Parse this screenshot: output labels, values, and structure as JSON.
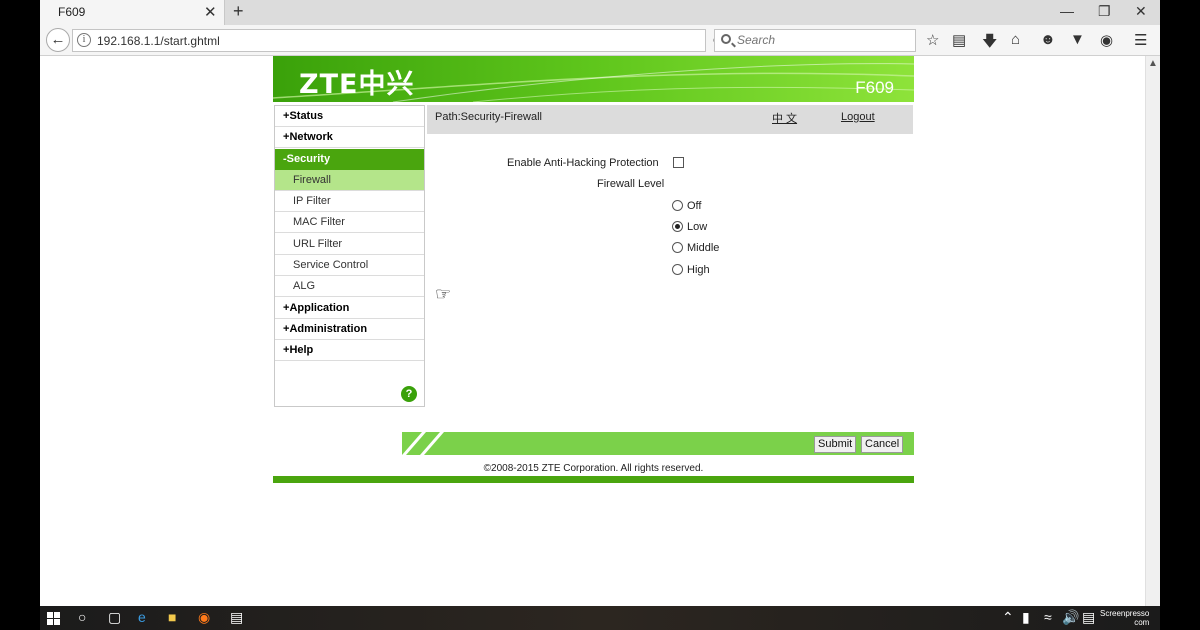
{
  "browser": {
    "tab_title": "F609",
    "tab_close": "✕",
    "new_tab": "+",
    "url": "192.168.1.1/start.ghtml",
    "search_placeholder": "Search",
    "window_controls": [
      "minimize-icon",
      "restore-icon",
      "close-icon"
    ],
    "toolbar_icons": [
      "star-icon",
      "reader-icon",
      "download-icon",
      "home-icon",
      "emoji-icon",
      "pocket-icon",
      "sync-icon",
      "menu-icon"
    ]
  },
  "router": {
    "logo": "ZTE中兴",
    "model": "F609",
    "menu": [
      {
        "sign": "+",
        "label": "Status",
        "level": "top",
        "active": false
      },
      {
        "sign": "+",
        "label": "Network",
        "level": "top",
        "active": false
      },
      {
        "sign": "-",
        "label": "Security",
        "level": "top",
        "active": true
      },
      {
        "sign": "",
        "label": "Firewall",
        "level": "sub",
        "active": true
      },
      {
        "sign": "",
        "label": "IP Filter",
        "level": "sub",
        "active": false
      },
      {
        "sign": "",
        "label": "MAC Filter",
        "level": "sub",
        "active": false
      },
      {
        "sign": "",
        "label": "URL Filter",
        "level": "sub",
        "active": false
      },
      {
        "sign": "",
        "label": "Service Control",
        "level": "sub",
        "active": false
      },
      {
        "sign": "",
        "label": "ALG",
        "level": "sub",
        "active": false
      },
      {
        "sign": "+",
        "label": "Application",
        "level": "top",
        "active": false
      },
      {
        "sign": "+",
        "label": "Administration",
        "level": "top",
        "active": false
      },
      {
        "sign": "+",
        "label": "Help",
        "level": "top",
        "active": false
      }
    ],
    "help_icon": "?",
    "path": "Path:Security-Firewall",
    "lang_link": "中 文",
    "logout": "Logout",
    "anti_hacking_label": "Enable Anti-Hacking Protection",
    "anti_hacking_checked": false,
    "firewall_level_label": "Firewall Level",
    "firewall_levels": [
      "Off",
      "Low",
      "Middle",
      "High"
    ],
    "firewall_selected": "Low",
    "submit": "Submit",
    "cancel": "Cancel",
    "copyright": "©2008-2015 ZTE Corporation. All rights reserved."
  },
  "taskbar": {
    "watermark_line1": "Screenpresso",
    "watermark_line2": "com"
  },
  "colors": {
    "zte_green": "#4aa50e",
    "active_sub": "#b4e58a",
    "footer_green": "#7bd14a"
  }
}
